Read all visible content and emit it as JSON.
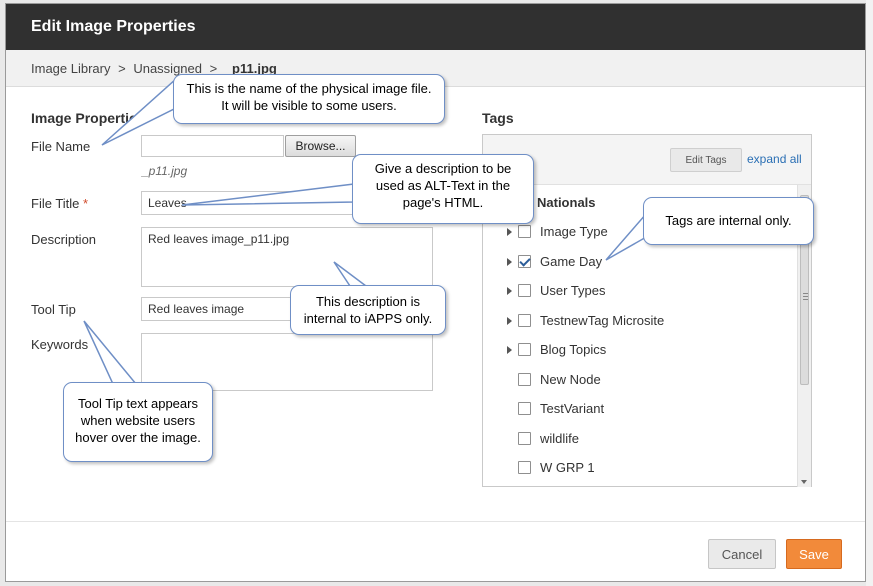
{
  "dialog": {
    "title": "Edit Image Properties"
  },
  "breadcrumb": {
    "items": [
      "Image Library",
      "Unassigned"
    ],
    "separator": ">",
    "current": "_p11.jpg"
  },
  "image_properties": {
    "heading": "Image Properties",
    "file_name": {
      "label": "File Name",
      "value": "",
      "browse_label": "Browse...",
      "hint": "_p11.jpg"
    },
    "file_title": {
      "label": "File Title",
      "required_mark": "*",
      "value": "Leaves"
    },
    "description": {
      "label": "Description",
      "value": "Red leaves image_p11.jpg"
    },
    "tool_tip": {
      "label": "Tool Tip",
      "value": "Red leaves image"
    },
    "keywords": {
      "label": "Keywords",
      "value": ""
    }
  },
  "tags": {
    "heading": "Tags",
    "edit_tags_label": "Edit Tags",
    "expand_all_label": "expand all",
    "root": "Nationals",
    "items": [
      {
        "label": "Image Type",
        "expandable": true,
        "checked": false
      },
      {
        "label": "Game Day",
        "expandable": true,
        "checked": true
      },
      {
        "label": "User Types",
        "expandable": true,
        "checked": false
      },
      {
        "label": "TestnewTag Microsite",
        "expandable": true,
        "checked": false
      },
      {
        "label": "Blog Topics",
        "expandable": true,
        "checked": false
      },
      {
        "label": "New Node",
        "expandable": false,
        "checked": false
      },
      {
        "label": "TestVariant",
        "expandable": false,
        "checked": false
      },
      {
        "label": "wildlife",
        "expandable": false,
        "checked": false
      },
      {
        "label": "W GRP 1",
        "expandable": false,
        "checked": false
      }
    ]
  },
  "footer": {
    "cancel_label": "Cancel",
    "save_label": "Save"
  },
  "callouts": {
    "file_name": "This is the name of the physical image file. It will be visible to some users.",
    "alt_text": "Give a description to be used as ALT-Text in the page's HTML.",
    "tags": "Tags are internal only.",
    "description": "This description is internal to iAPPS only.",
    "tool_tip": "Tool Tip text appears when website users hover over the image."
  },
  "colors": {
    "titlebar": "#303030",
    "save": "#f28a3a",
    "link": "#2a6fb4",
    "callout_border": "#6f8fc6"
  }
}
